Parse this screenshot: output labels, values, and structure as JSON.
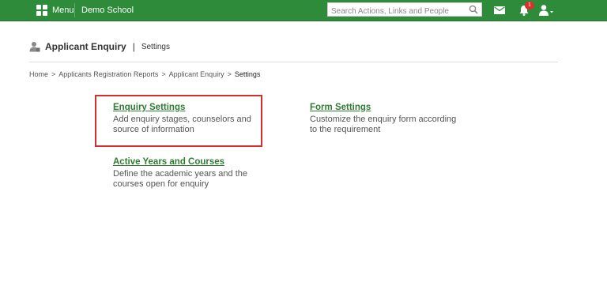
{
  "topbar": {
    "menu_label": "Menu",
    "school_name": "Demo School",
    "search_placeholder": "Search Actions, Links and People",
    "notification_count": "1",
    "colors": {
      "bar": "#2e8b3a",
      "badge": "#d9302b"
    }
  },
  "page": {
    "title": "Applicant Enquiry",
    "subtitle": "Settings"
  },
  "breadcrumb": [
    "Home",
    "Applicants Registration Reports",
    "Applicant Enquiry",
    "Settings"
  ],
  "settings": {
    "enquiry": {
      "title": "Enquiry Settings",
      "desc_line1": "Add enquiry stages, counselors and",
      "desc_line2": "source of information"
    },
    "form": {
      "title": "Form Settings",
      "desc_line1": "Customize the enquiry form according",
      "desc_line2": "to the requirement"
    },
    "years": {
      "title": "Active Years and Courses",
      "desc_line1": "Define the academic years and the",
      "desc_line2": "courses open for enquiry"
    }
  },
  "icons": [
    "grid-icon",
    "search-icon",
    "mail-icon",
    "bell-icon",
    "user-icon",
    "applicant-icon"
  ],
  "link_color": "#2e7d32",
  "highlight_color": "#d32f2f"
}
